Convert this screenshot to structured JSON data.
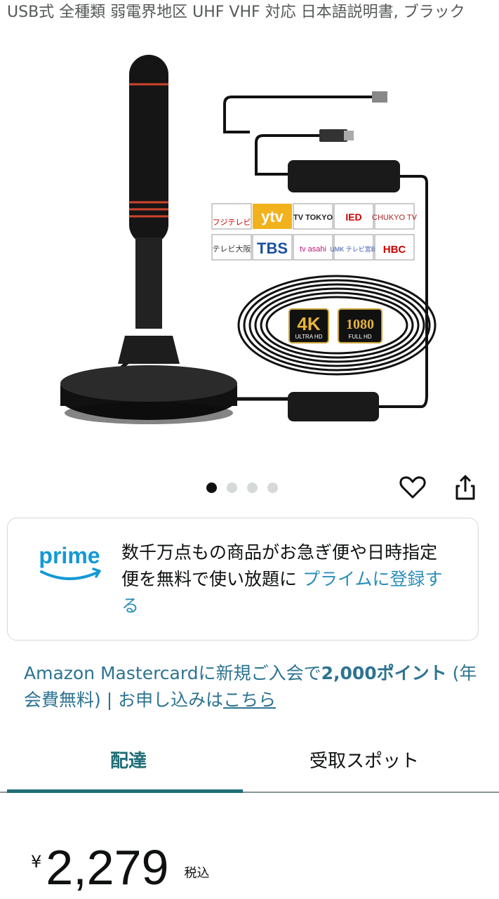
{
  "product": {
    "title": "USB式 全種類 弱電界地区 UHF VHF 対応 日本語説明書, ブラック",
    "image_channels_row1": [
      "フジテレビ",
      "ytv",
      "TV TOKYO",
      "IED",
      "CHUKYO TV"
    ],
    "image_channels_row2": [
      "テレビ大阪",
      "TBS",
      "tv asahi",
      "UMK テレビ宮崎",
      "HBC"
    ],
    "image_badges": [
      "4K",
      "ULTRA HD",
      "1080",
      "FULL HD"
    ]
  },
  "carousel": {
    "total": 4,
    "active": 1
  },
  "icons": {
    "favorite": "heart-icon",
    "share": "share-icon"
  },
  "prime": {
    "logo": "prime",
    "message": "数千万点もの商品がお急ぎ便や日時指定便を無料で使い放題に",
    "link": "プライムに登録する"
  },
  "mastercard_promo": {
    "prefix": "Amazon Mastercardに新規ご入会で",
    "points": "2,000ポイント",
    "middle": " (年会費無料) | お申し込みは",
    "link": "こちら"
  },
  "tabs": [
    {
      "label": "配達",
      "selected": true
    },
    {
      "label": "受取スポット",
      "selected": false
    }
  ],
  "price": {
    "currency": "¥",
    "amount": "2,279",
    "tax_label": "税込"
  },
  "colors": {
    "accent": "#1f6e78",
    "link": "#2d7391",
    "prime_blue": "#1399d6"
  }
}
